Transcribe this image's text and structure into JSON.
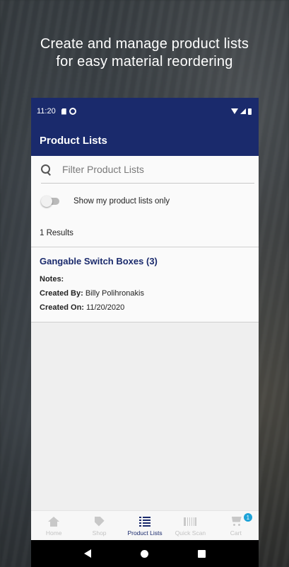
{
  "headline": {
    "line1": "Create and manage product lists",
    "line2": "for easy material reordering"
  },
  "status_bar": {
    "time": "11:20",
    "icons": [
      "sd-card-icon",
      "at-sign-icon",
      "wifi-icon",
      "signal-icon",
      "battery-icon"
    ]
  },
  "app_bar": {
    "title": "Product Lists"
  },
  "search": {
    "placeholder": "Filter Product Lists",
    "value": ""
  },
  "filter_toggle": {
    "label": "Show my product lists only",
    "checked": false
  },
  "results": {
    "text": "1 Results"
  },
  "lists": [
    {
      "title": "Gangable Switch Boxes (3)",
      "notes_label": "Notes:",
      "notes_value": "",
      "created_by_label": "Created By:",
      "created_by_value": "Billy Polihronakis",
      "created_on_label": "Created On:",
      "created_on_value": "11/20/2020"
    }
  ],
  "bottom_nav": {
    "items": [
      {
        "label": "Home",
        "icon": "home-icon",
        "active": false
      },
      {
        "label": "Shop",
        "icon": "tag-icon",
        "active": false
      },
      {
        "label": "Product Lists",
        "icon": "list-icon",
        "active": true
      },
      {
        "label": "Quick Scan",
        "icon": "barcode-icon",
        "active": false
      },
      {
        "label": "Cart",
        "icon": "cart-icon",
        "active": false,
        "badge": "1"
      }
    ]
  },
  "colors": {
    "primary": "#1a2a6c",
    "badge": "#1ea3d8",
    "inactive": "#c2c2c2"
  }
}
